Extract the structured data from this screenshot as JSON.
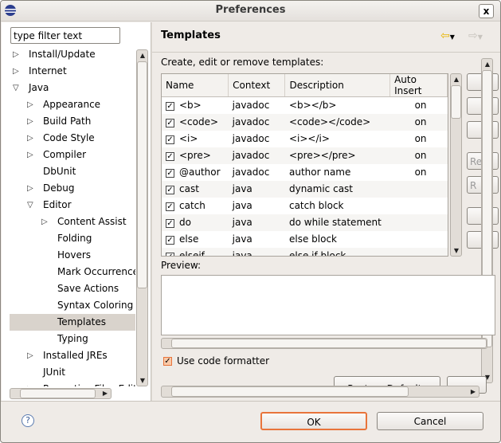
{
  "window": {
    "title": "Preferences",
    "close": "x"
  },
  "filter": {
    "placeholder": "type filter text",
    "value": "type filter text"
  },
  "tree": [
    {
      "label": "Install/Update",
      "level": 0,
      "expander": "collapsed"
    },
    {
      "label": "Internet",
      "level": 0,
      "expander": "collapsed"
    },
    {
      "label": "Java",
      "level": 0,
      "expander": "expanded"
    },
    {
      "label": "Appearance",
      "level": 1,
      "expander": "collapsed"
    },
    {
      "label": "Build Path",
      "level": 1,
      "expander": "collapsed"
    },
    {
      "label": "Code Style",
      "level": 1,
      "expander": "collapsed"
    },
    {
      "label": "Compiler",
      "level": 1,
      "expander": "collapsed"
    },
    {
      "label": "DbUnit",
      "level": 1,
      "expander": "none"
    },
    {
      "label": "Debug",
      "level": 1,
      "expander": "collapsed"
    },
    {
      "label": "Editor",
      "level": 1,
      "expander": "expanded"
    },
    {
      "label": "Content Assist",
      "level": 2,
      "expander": "collapsed"
    },
    {
      "label": "Folding",
      "level": 2,
      "expander": "none"
    },
    {
      "label": "Hovers",
      "level": 2,
      "expander": "none"
    },
    {
      "label": "Mark Occurrences",
      "level": 2,
      "expander": "none"
    },
    {
      "label": "Save Actions",
      "level": 2,
      "expander": "none"
    },
    {
      "label": "Syntax Coloring",
      "level": 2,
      "expander": "none"
    },
    {
      "label": "Templates",
      "level": 2,
      "expander": "none",
      "selected": true
    },
    {
      "label": "Typing",
      "level": 2,
      "expander": "none"
    },
    {
      "label": "Installed JREs",
      "level": 1,
      "expander": "collapsed"
    },
    {
      "label": "JUnit",
      "level": 1,
      "expander": "none"
    },
    {
      "label": "Properties Files Editor",
      "level": 1,
      "expander": "collapsed"
    }
  ],
  "page": {
    "title": "Templates",
    "description": "Create, edit or remove templates:",
    "preview_label": "Preview:",
    "use_formatter": {
      "label": "Use code formatter",
      "checked": true
    },
    "restore_defaults": "Restore Defaults"
  },
  "table": {
    "columns": [
      "Name",
      "Context",
      "Description",
      "Auto Insert"
    ],
    "rows": [
      {
        "checked": true,
        "name": "<b>",
        "context": "javadoc",
        "description": "<b></b>",
        "auto": "on"
      },
      {
        "checked": true,
        "name": "<code>",
        "context": "javadoc",
        "description": "<code></code>",
        "auto": "on"
      },
      {
        "checked": true,
        "name": "<i>",
        "context": "javadoc",
        "description": "<i></i>",
        "auto": "on"
      },
      {
        "checked": true,
        "name": "<pre>",
        "context": "javadoc",
        "description": "<pre></pre>",
        "auto": "on"
      },
      {
        "checked": true,
        "name": "@author",
        "context": "javadoc",
        "description": "author name",
        "auto": "on"
      },
      {
        "checked": true,
        "name": "cast",
        "context": "java",
        "description": "dynamic cast",
        "auto": ""
      },
      {
        "checked": true,
        "name": "catch",
        "context": "java",
        "description": "catch block",
        "auto": ""
      },
      {
        "checked": true,
        "name": "do",
        "context": "java",
        "description": "do while statement",
        "auto": ""
      },
      {
        "checked": true,
        "name": "else",
        "context": "java",
        "description": "else block",
        "auto": ""
      },
      {
        "checked": true,
        "name": "elseif",
        "context": "java",
        "description": "else if block",
        "auto": ""
      }
    ]
  },
  "side_buttons": [
    "",
    "",
    "",
    "Re",
    "R",
    "",
    ""
  ],
  "footer": {
    "ok": "OK",
    "cancel": "Cancel",
    "help": "?"
  },
  "colors": {
    "accent": "#e8743b",
    "selection": "#d9d3cc",
    "nav_arrow": "#e8b400"
  }
}
